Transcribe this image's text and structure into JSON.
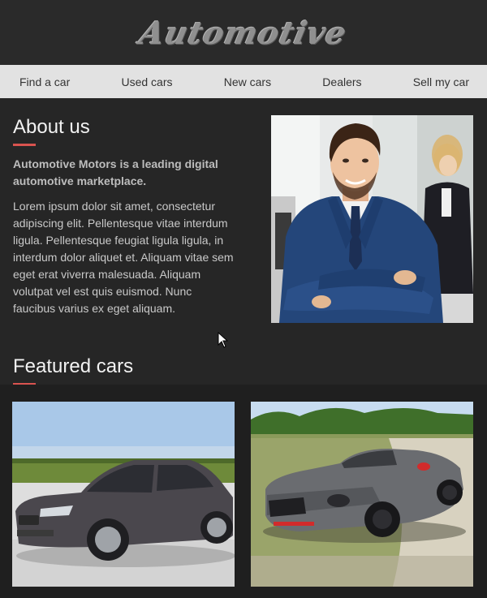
{
  "header": {
    "logo": "Automotive"
  },
  "nav": {
    "items": [
      "Find a car",
      "Used cars",
      "New cars",
      "Dealers",
      "Sell my car"
    ]
  },
  "about": {
    "title": "About us",
    "lead": "Automotive Motors is a leading digital automotive marketplace.",
    "body": "Lorem ipsum dolor sit amet, consectetur adipiscing elit. Pellentesque vitae interdum ligula. Pellentesque feugiat ligula ligula, in interdum dolor aliquet et. Aliquam vitae sem eget erat viverra malesuada. Aliquam volutpat vel est quis euismod. Nunc faucibus varius ex eget aliquam."
  },
  "featured": {
    "title": "Featured cars"
  },
  "colors": {
    "accent": "#d9534f",
    "nav_bg": "#e2e2e2",
    "page_bg": "#262626"
  }
}
